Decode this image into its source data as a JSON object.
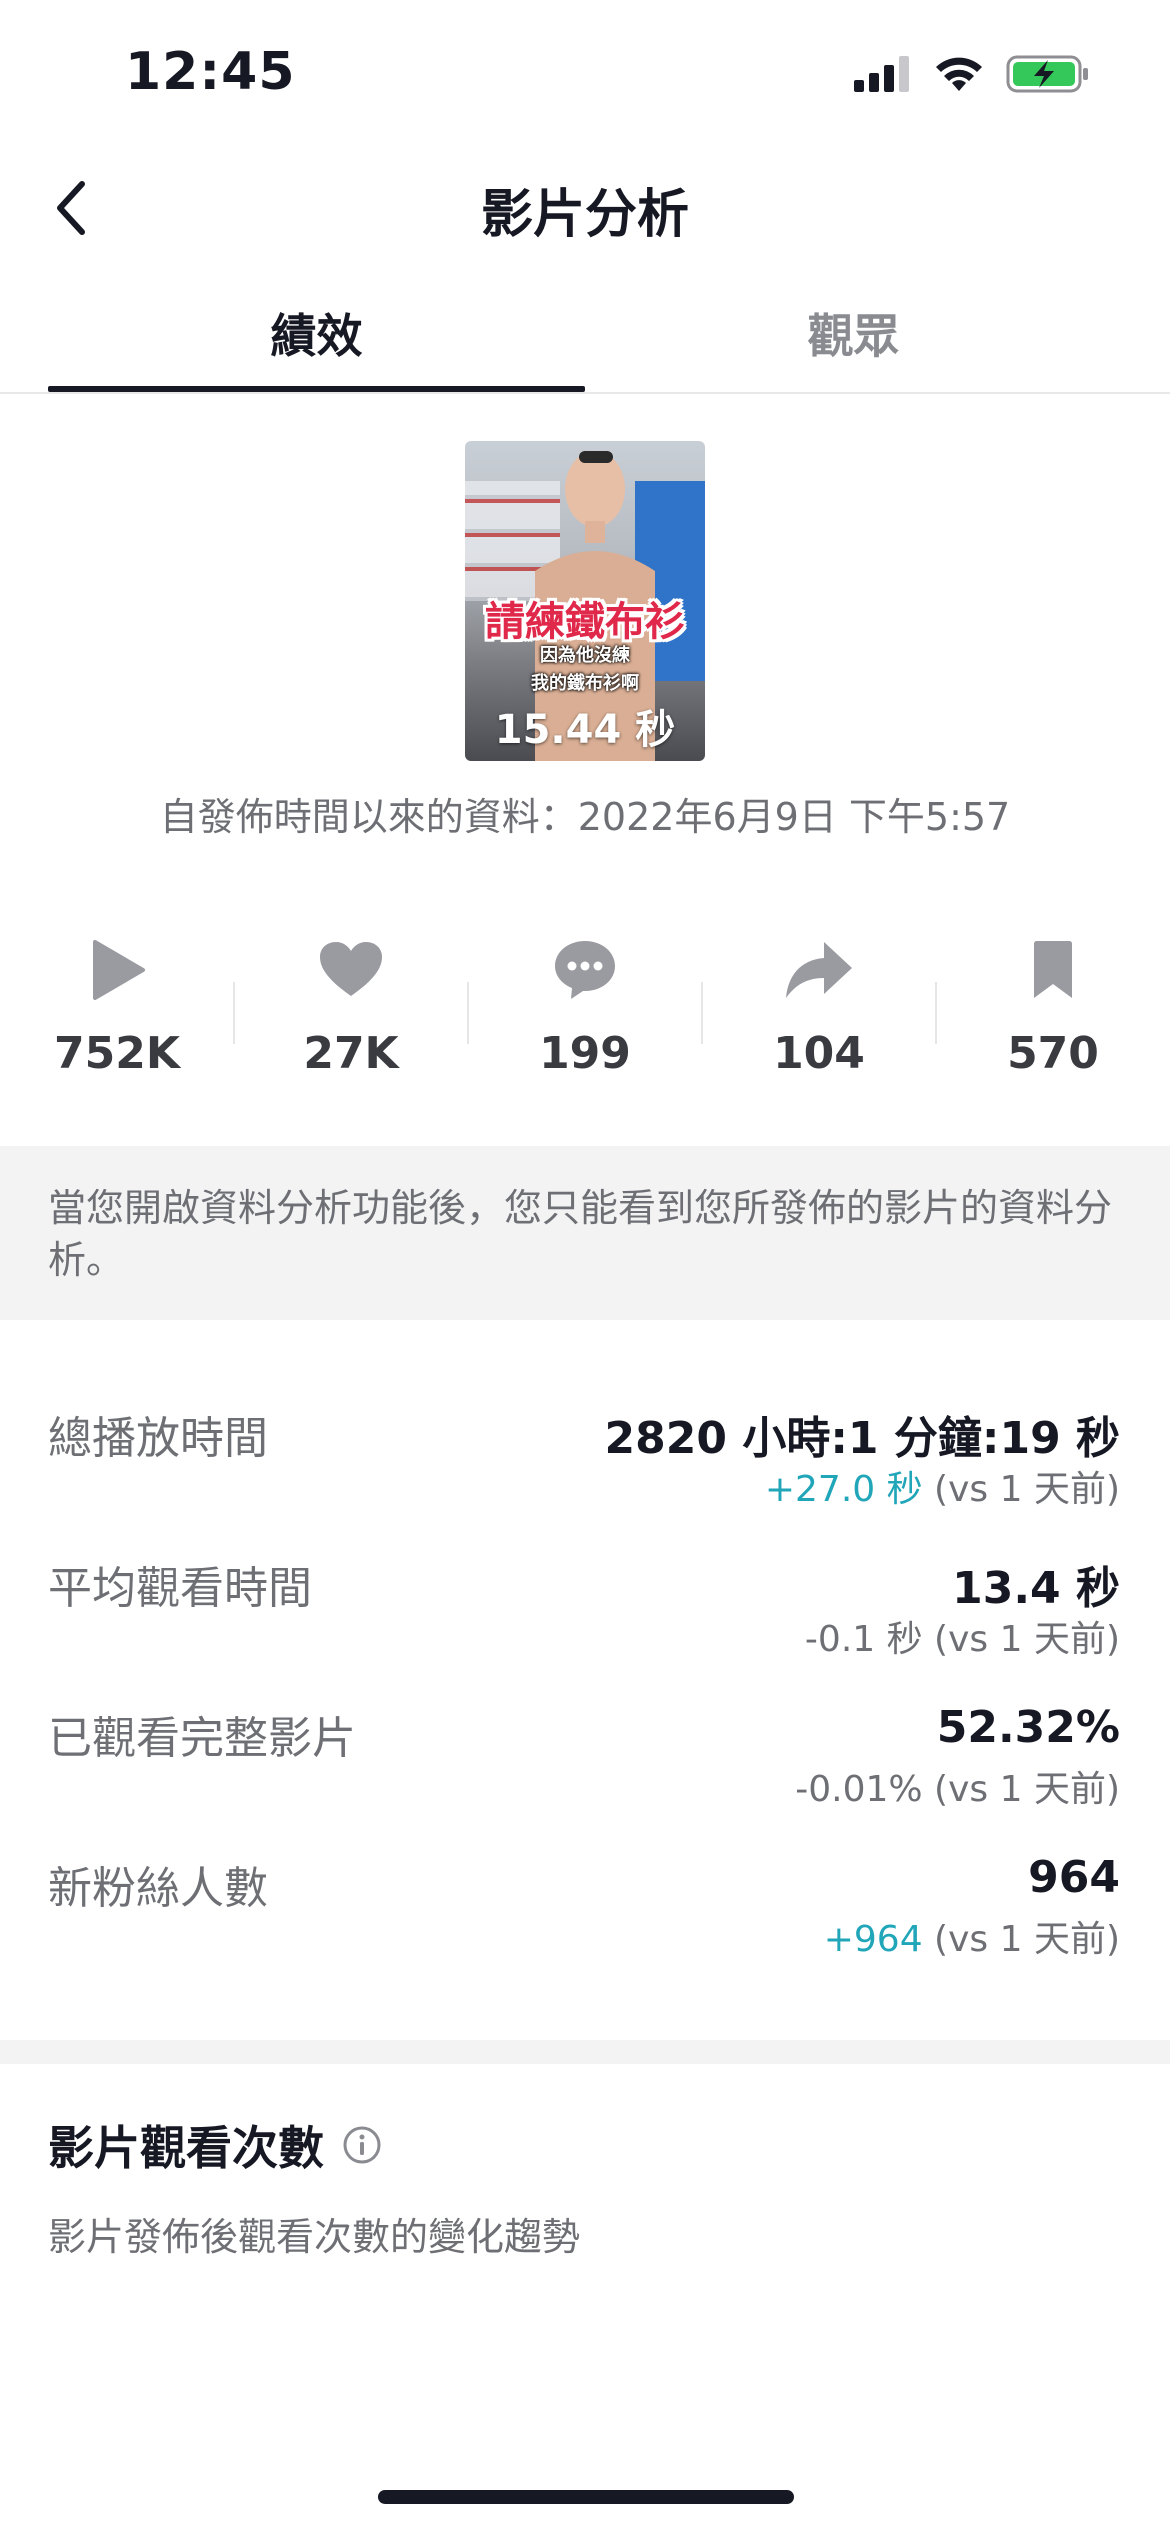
{
  "status_bar": {
    "time": "12:45"
  },
  "header": {
    "title": "影片分析"
  },
  "tabs": [
    {
      "label": "績效",
      "active": true
    },
    {
      "label": "觀眾",
      "active": false
    }
  ],
  "video": {
    "overlay_title": "請練鐵布衫",
    "overlay_line1": "因為他沒練",
    "overlay_line2": "我的鐵布衫啊",
    "duration": "15.44 秒",
    "since_text": "自發佈時間以來的資料：2022年6月9日 下午5:57"
  },
  "stats": [
    {
      "icon": "play-icon",
      "value": "752K"
    },
    {
      "icon": "heart-icon",
      "value": "27K"
    },
    {
      "icon": "comment-icon",
      "value": "199"
    },
    {
      "icon": "share-icon",
      "value": "104"
    },
    {
      "icon": "bookmark-icon",
      "value": "570"
    }
  ],
  "info_banner": "當您開啟資料分析功能後，您只能看到您所發佈的影片的資料分析。",
  "metrics": [
    {
      "label": "總播放時間",
      "value": "2820 小時:1 分鐘:19 秒",
      "delta": "+27.0 秒",
      "delta_positive": true,
      "compare": " (vs 1 天前)"
    },
    {
      "label": "平均觀看時間",
      "value": "13.4 秒",
      "delta": "-0.1 秒",
      "delta_positive": false,
      "compare": " (vs 1 天前)"
    },
    {
      "label": "已觀看完整影片",
      "value": "52.32%",
      "delta": "-0.01%",
      "delta_positive": false,
      "compare": " (vs 1 天前)"
    },
    {
      "label": "新粉絲人數",
      "value": "964",
      "delta": "+964",
      "delta_positive": true,
      "compare": " (vs 1 天前)"
    }
  ],
  "views_section": {
    "title": "影片觀看次數",
    "subtitle": "影片發佈後觀看次數的變化趨勢"
  },
  "colors": {
    "positive": "#20a6b8",
    "text": "#161823",
    "muted": "#6e6f74"
  }
}
